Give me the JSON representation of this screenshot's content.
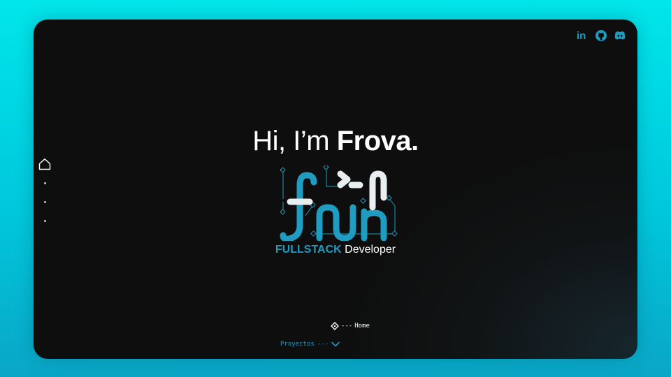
{
  "colors": {
    "accent": "#1f9cc0",
    "text": "#ffffff",
    "background": "#0e0e0e"
  },
  "social": [
    {
      "name": "linkedin-icon",
      "label": "in"
    },
    {
      "name": "github-icon"
    },
    {
      "name": "discord-icon"
    }
  ],
  "side_nav": {
    "items": [
      "home-icon",
      "nav-dot",
      "nav-dot",
      "nav-dot"
    ]
  },
  "hero": {
    "greeting": "Hi, I’m ",
    "name": "Frova.",
    "role_accent": "FULLSTACK",
    "role_rest": " Developer"
  },
  "scroll_nav": {
    "current_dashes": "---",
    "current_label": "Home",
    "next_label": "Proyectos",
    "next_dashes": "---"
  }
}
